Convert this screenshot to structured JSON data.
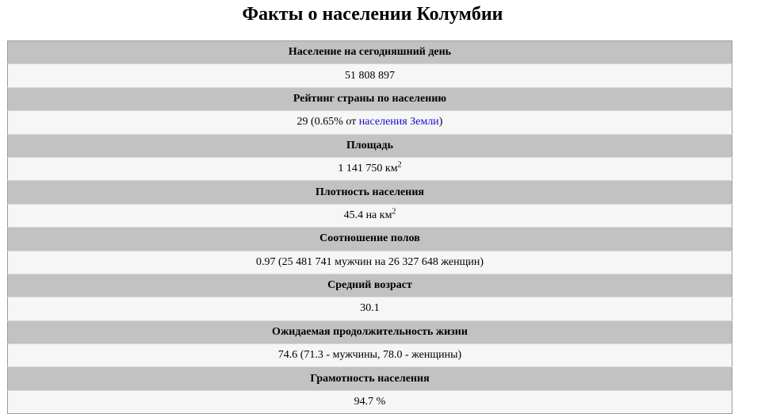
{
  "page": {
    "title": "Факты о населении Колумбии"
  },
  "facts": {
    "population": {
      "label": "Население на сегодняшний день",
      "value": "51 808 897"
    },
    "rank": {
      "label": "Рейтинг страны по населению",
      "value_prefix": "29 (0.65% от ",
      "link_text": "населения Земли",
      "value_suffix": ")"
    },
    "area": {
      "label": "Площадь",
      "value": "1 141 750 км",
      "sup": "2"
    },
    "density": {
      "label": "Плотность населения",
      "value": "45.4 на км",
      "sup": "2"
    },
    "sex_ratio": {
      "label": "Соотношение полов",
      "value": "0.97 (25 481 741 мужчин на 26 327 648 женщин)"
    },
    "median_age": {
      "label": "Средний возраст",
      "value": "30.1"
    },
    "life_expectancy": {
      "label": "Ожидаемая продолжительность жизни",
      "value": "74.6 (71.3 - мужчины, 78.0 - женщины)"
    },
    "literacy": {
      "label": "Грамотность населения",
      "value": "94.7 %"
    }
  },
  "colors": {
    "header_bg": "#c2c2c2",
    "value_bg": "#f6f6f6",
    "link": "#1a0dcc"
  }
}
